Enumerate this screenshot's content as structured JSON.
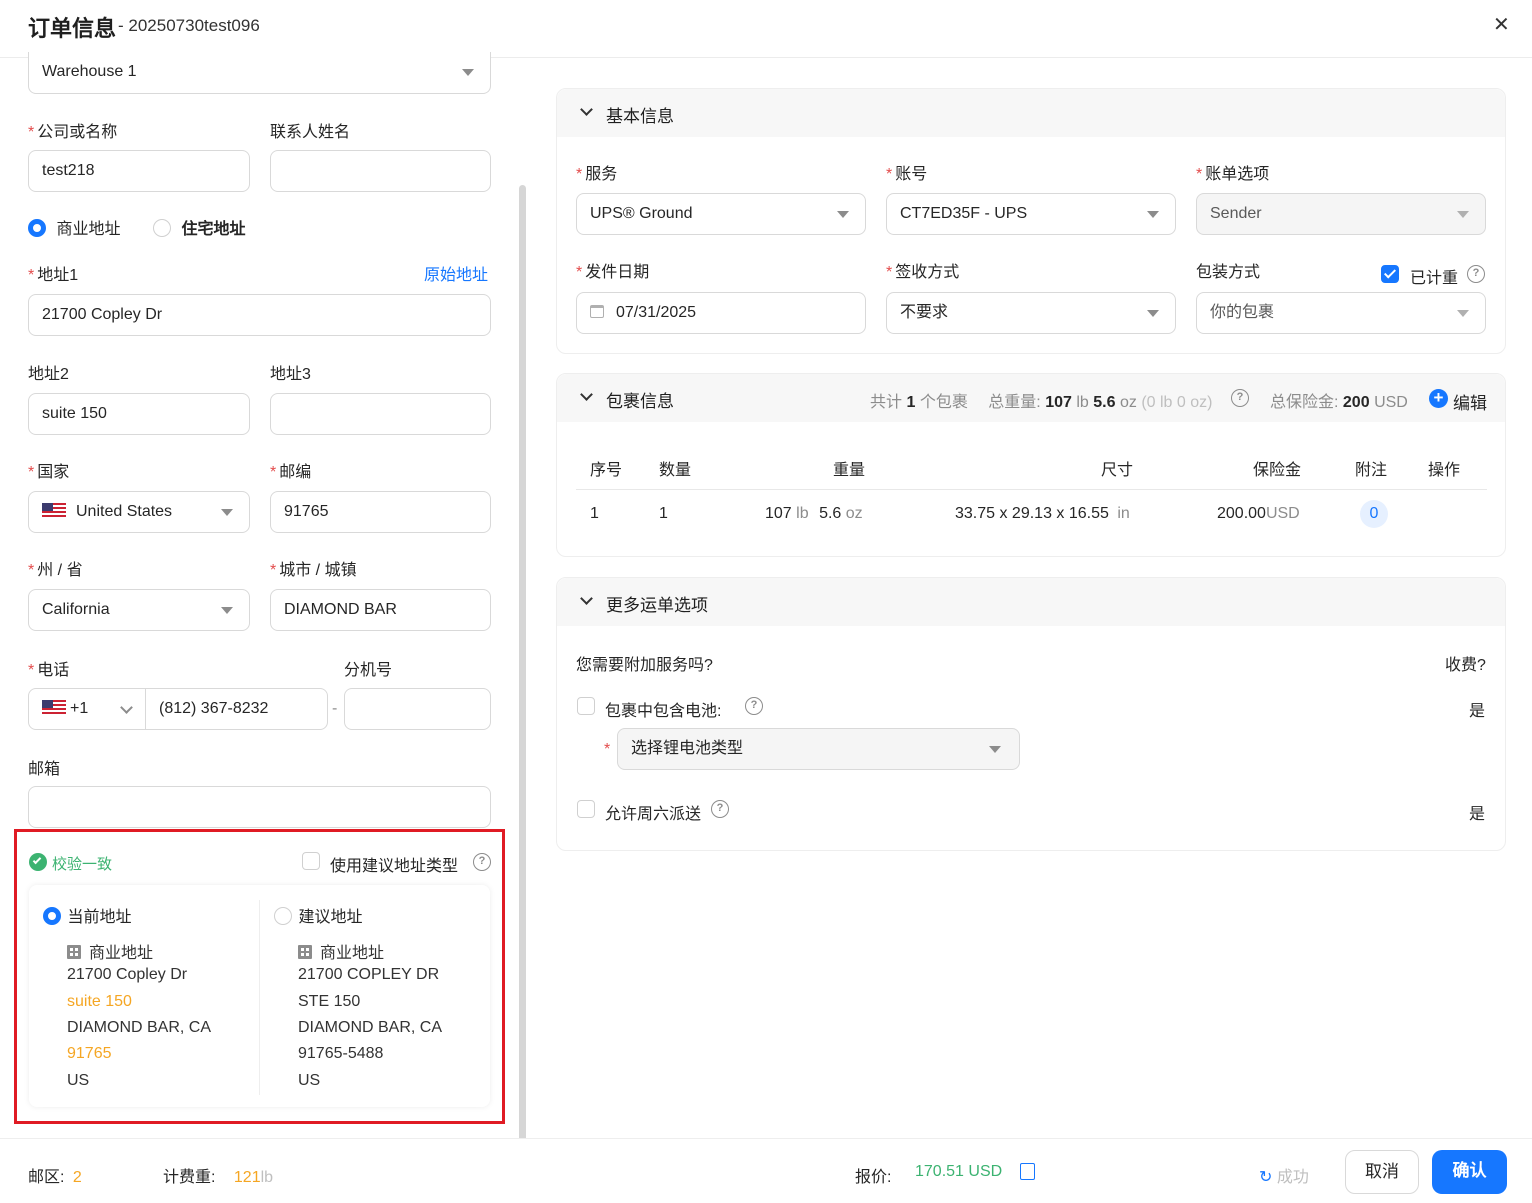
{
  "header": {
    "title": "订单信息",
    "subtitle": "- 20250730test096"
  },
  "left": {
    "warehouse": "Warehouse 1",
    "company_label": "公司或名称",
    "company_value": "test218",
    "contact_label": "联系人姓名",
    "contact_value": "",
    "address_type_commercial": "商业地址",
    "address_type_residential": "住宅地址",
    "addr1_label": "地址1",
    "original_address_link": "原始地址",
    "addr1_value": "21700 Copley Dr",
    "addr2_label": "地址2",
    "addr2_value": "suite 150",
    "addr3_label": "地址3",
    "addr3_value": "",
    "country_label": "国家",
    "country_value": "United States",
    "zip_label": "邮编",
    "zip_value": "91765",
    "state_label": "州 / 省",
    "state_value": "California",
    "city_label": "城市 / 城镇",
    "city_value": "DIAMOND BAR",
    "phone_label": "电话",
    "phone_code": "+1",
    "phone_value": "(812) 367-8232",
    "ext_label": "分机号",
    "ext_dash": "-",
    "ext_value": "",
    "email_label": "邮箱",
    "email_value": "",
    "verify": {
      "status": "校验一致",
      "use_suggested_label": "使用建议地址类型",
      "current": {
        "title": "当前地址",
        "type": "商业地址",
        "line1": "21700 Copley Dr",
        "line2": "suite 150",
        "line3": "DIAMOND BAR, CA",
        "line4": "91765",
        "line5": "US"
      },
      "suggested": {
        "title": "建议地址",
        "type": "商业地址",
        "line1": "21700 COPLEY DR",
        "line2": "STE 150",
        "line3": "DIAMOND BAR, CA",
        "line4": "91765-5488",
        "line5": "US"
      }
    }
  },
  "basic": {
    "title": "基本信息",
    "service_label": "服务",
    "service_value": "UPS® Ground",
    "account_label": "账号",
    "account_value": "CT7ED35F - UPS",
    "billing_label": "账单选项",
    "billing_value": "Sender",
    "ship_date_label": "发件日期",
    "ship_date_value": "07/31/2025",
    "signature_label": "签收方式",
    "signature_value": "不要求",
    "packaging_label": "包装方式",
    "weighed_label": "已计重",
    "packaging_value": "你的包裹"
  },
  "package": {
    "title": "包裹信息",
    "total_prefix": "共计",
    "total_count": "1",
    "total_suffix": "个包裹",
    "weight_label": "总重量:",
    "weight_lb": "107",
    "lb_unit": "lb",
    "weight_oz": "5.6",
    "oz_unit": "oz",
    "weight_extra": "(0 lb 0 oz)",
    "insurance_label": "总保险金:",
    "insurance_value": "200",
    "insurance_unit": "USD",
    "edit_label": "编辑",
    "columns": [
      "序号",
      "数量",
      "重量",
      "尺寸",
      "保险金",
      "附注",
      "操作"
    ],
    "row": {
      "index": "1",
      "qty": "1",
      "weight_lb": "107",
      "weight_lb_unit": "lb",
      "weight_oz": "5.6",
      "weight_oz_unit": "oz",
      "dims": "33.75 x 29.13 x 16.55",
      "dims_unit": "in",
      "insurance": "200.00",
      "insurance_unit": "USD",
      "notes_count": "0"
    }
  },
  "more": {
    "title": "更多运单选项",
    "question": "您需要附加服务吗?",
    "charge_col": "收费?",
    "battery_label": "包裹中包含电池:",
    "battery_charge": "是",
    "battery_select_placeholder": "选择锂电池类型",
    "saturday_label": "允许周六派送",
    "saturday_charge": "是"
  },
  "footer": {
    "zone_label": "邮区:",
    "zone_value": "2",
    "billable_label": "计费重:",
    "billable_value": "121",
    "billable_unit": "lb",
    "quote_label": "报价:",
    "quote_value": "170.51 USD",
    "status": "成功",
    "cancel": "取消",
    "confirm": "确认"
  },
  "colors": {
    "primary": "#1677ff",
    "orange": "#f5a623",
    "green": "#3cb371",
    "required": "#e34d4d"
  }
}
